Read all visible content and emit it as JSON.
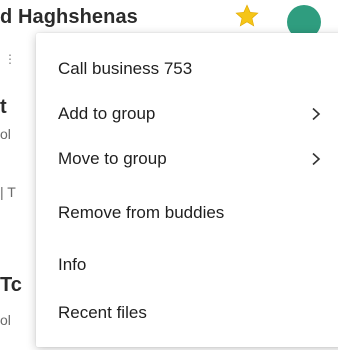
{
  "background": {
    "contact_name": "d Haghshenas",
    "avatar_initial": "",
    "fragments": [
      "t",
      "ol",
      "| T",
      "Tc",
      "ol"
    ]
  },
  "context_menu": {
    "items": [
      {
        "label": "Call business 753",
        "has_submenu": false
      },
      {
        "label": "Add to group",
        "has_submenu": true
      },
      {
        "label": "Move to group",
        "has_submenu": true
      },
      {
        "label": "Remove from buddies",
        "has_submenu": false
      },
      {
        "label": "Info",
        "has_submenu": false
      },
      {
        "label": "Recent files",
        "has_submenu": false
      }
    ]
  },
  "colors": {
    "star": "#f5c518",
    "avatar": "#2f9d7f",
    "menu_background": "#ffffff"
  },
  "icons": {
    "star": "star-icon",
    "submenu": "chevron-right-icon"
  }
}
